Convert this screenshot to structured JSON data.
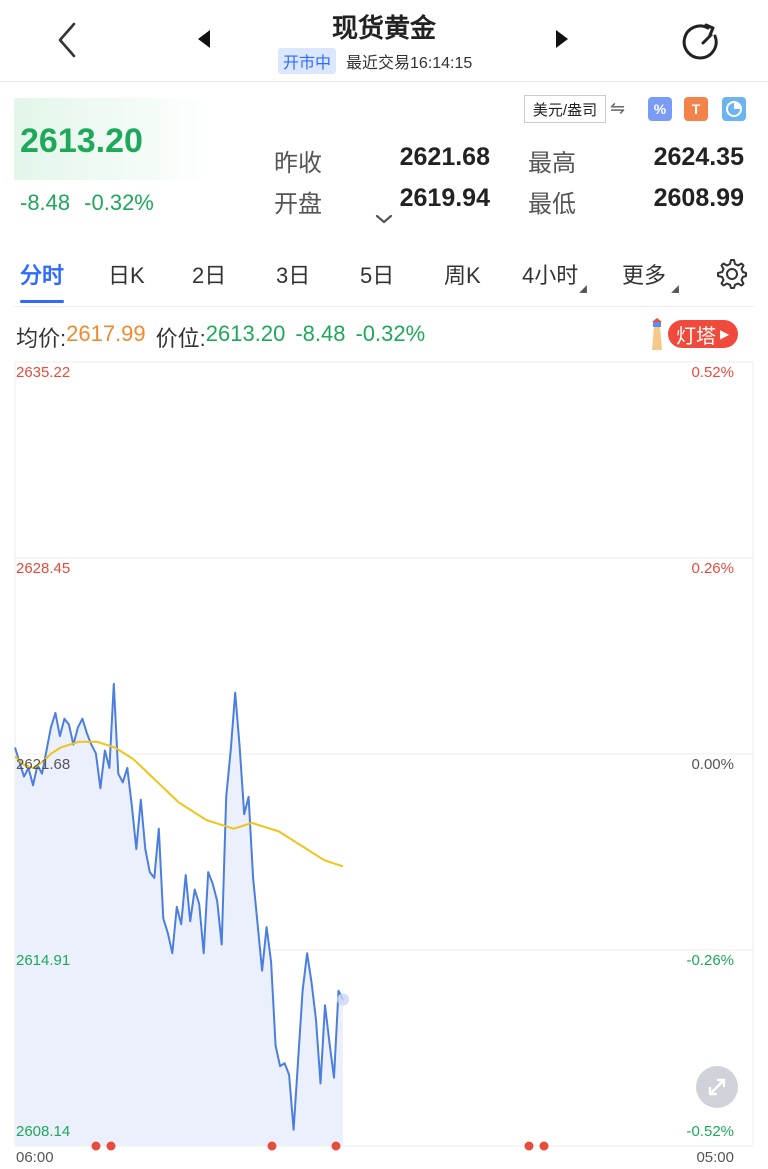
{
  "header": {
    "title": "现货黄金",
    "status_badge": "开市中",
    "last_trade": "最近交易16:14:15"
  },
  "quote": {
    "price": "2613.20",
    "change": "-8.48",
    "change_pct": "-0.32%",
    "prev_close_label": "昨收",
    "prev_close": "2621.68",
    "open_label": "开盘",
    "open": "2619.94",
    "high_label": "最高",
    "high": "2624.35",
    "low_label": "最低",
    "low": "2608.99",
    "unit": "美元/盎司",
    "tool_icons": [
      "percent-icon",
      "lighthouse-icon",
      "pie-chart-icon"
    ]
  },
  "tabs": [
    {
      "label": "分时",
      "active": true
    },
    {
      "label": "日K"
    },
    {
      "label": "2日"
    },
    {
      "label": "3日"
    },
    {
      "label": "5日"
    },
    {
      "label": "周K"
    },
    {
      "label": "4小时"
    },
    {
      "label": "更多"
    }
  ],
  "avg_row": {
    "avg_label": "均价:",
    "avg_value": "2617.99",
    "price_label": "价位:",
    "price_value": "2613.20",
    "change": "-8.48",
    "change_pct": "-0.32%",
    "badge": "灯塔"
  },
  "colors": {
    "up": "#e74c3c",
    "down": "#1ea85a",
    "accent": "#2f6bff",
    "avg_line": "#f0c419",
    "price_line": "#4a7fe0",
    "area_fill": "#eceffc"
  },
  "chart_data": {
    "type": "line",
    "y_left_labels": [
      "2635.22",
      "2628.45",
      "2621.68",
      "2614.91",
      "2608.14"
    ],
    "y_right_labels": [
      "0.52%",
      "0.26%",
      "0.00%",
      "-0.26%",
      "-0.52%"
    ],
    "x_labels": [
      "06:00",
      "05:00"
    ],
    "ylim": [
      2608.14,
      2635.22
    ],
    "series": [
      {
        "name": "价位",
        "values": [
          2621.9,
          2621.4,
          2620.9,
          2621.2,
          2620.6,
          2621.3,
          2621.0,
          2621.8,
          2622.6,
          2623.1,
          2622.3,
          2622.9,
          2622.7,
          2622.0,
          2622.6,
          2622.9,
          2622.4,
          2622.0,
          2621.7,
          2620.5,
          2621.8,
          2621.2,
          2624.1,
          2621.0,
          2620.7,
          2621.2,
          2619.9,
          2618.4,
          2620.1,
          2618.4,
          2617.6,
          2617.4,
          2619.1,
          2616.0,
          2615.5,
          2614.8,
          2616.4,
          2615.8,
          2617.5,
          2615.9,
          2617.0,
          2616.5,
          2614.8,
          2617.6,
          2617.2,
          2616.6,
          2615.1,
          2620.2,
          2621.8,
          2623.8,
          2621.9,
          2619.6,
          2620.2,
          2617.4,
          2615.8,
          2614.2,
          2615.7,
          2614.5,
          2611.6,
          2610.9,
          2611.0,
          2610.6,
          2608.7,
          2611.1,
          2613.5,
          2614.8,
          2613.8,
          2612.5,
          2610.3,
          2613.0,
          2611.7,
          2610.5,
          2613.5,
          2613.2
        ]
      },
      {
        "name": "均价",
        "values": [
          2621.6,
          2621.3,
          2621.2,
          2621.4,
          2621.7,
          2621.9,
          2622.0,
          2622.1,
          2622.1,
          2622.1,
          2622.0,
          2621.9,
          2621.7,
          2621.5,
          2621.2,
          2620.9,
          2620.6,
          2620.3,
          2620.0,
          2619.8,
          2619.6,
          2619.4,
          2619.3,
          2619.2,
          2619.1,
          2619.2,
          2619.3,
          2619.2,
          2619.1,
          2619.0,
          2618.8,
          2618.6,
          2618.4,
          2618.2,
          2618.0,
          2617.9,
          2617.8
        ]
      }
    ],
    "markers": [
      "up",
      "up",
      "up",
      "up",
      "up",
      "up"
    ]
  }
}
